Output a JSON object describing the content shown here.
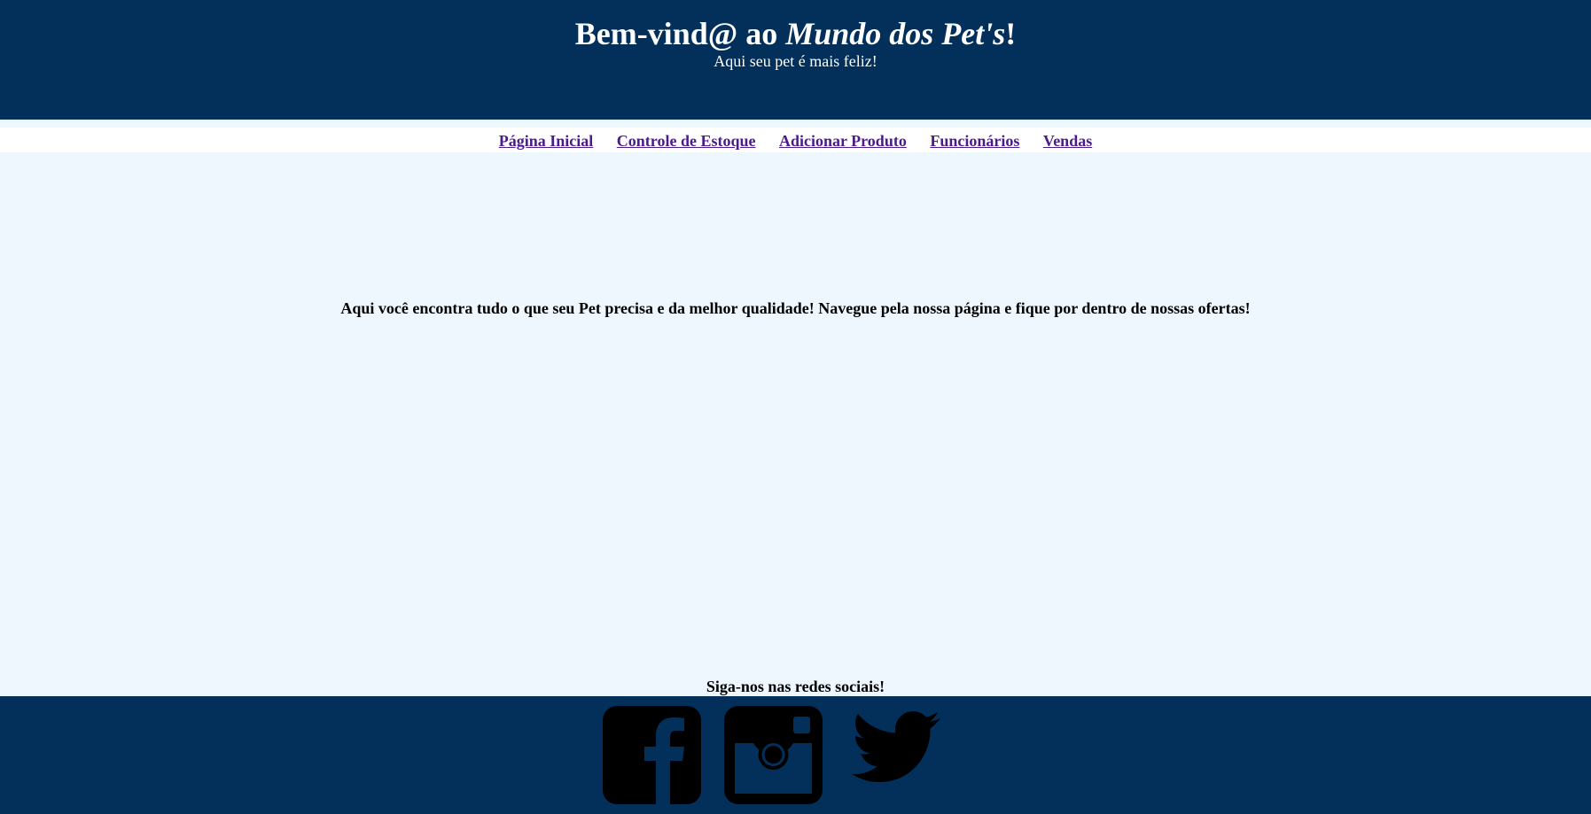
{
  "header": {
    "title_prefix": "Bem-vind@ ao ",
    "title_brand": "Mundo dos Pet's",
    "title_suffix": "!",
    "subtitle": "Aqui seu pet é mais feliz!"
  },
  "nav": {
    "items": [
      {
        "label": "Página Inicial"
      },
      {
        "label": "Controle de Estoque"
      },
      {
        "label": "Adicionar Produto"
      },
      {
        "label": "Funcionários"
      },
      {
        "label": "Vendas"
      }
    ]
  },
  "main": {
    "intro": "Aqui você encontra tudo o que seu Pet precisa e da melhor qualidade! Navegue pela nossa página e fique por dentro de nossas ofertas!"
  },
  "footer": {
    "follow_text": "Siga-nos nas redes sociais!",
    "social": [
      {
        "icon": "facebook-icon"
      },
      {
        "icon": "instagram-icon"
      },
      {
        "icon": "twitter-icon"
      }
    ]
  },
  "colors": {
    "header_bg": "#02305a",
    "page_bg": "#eef7fd",
    "nav_bg": "#ffffff",
    "link": "#4b1a8c"
  }
}
